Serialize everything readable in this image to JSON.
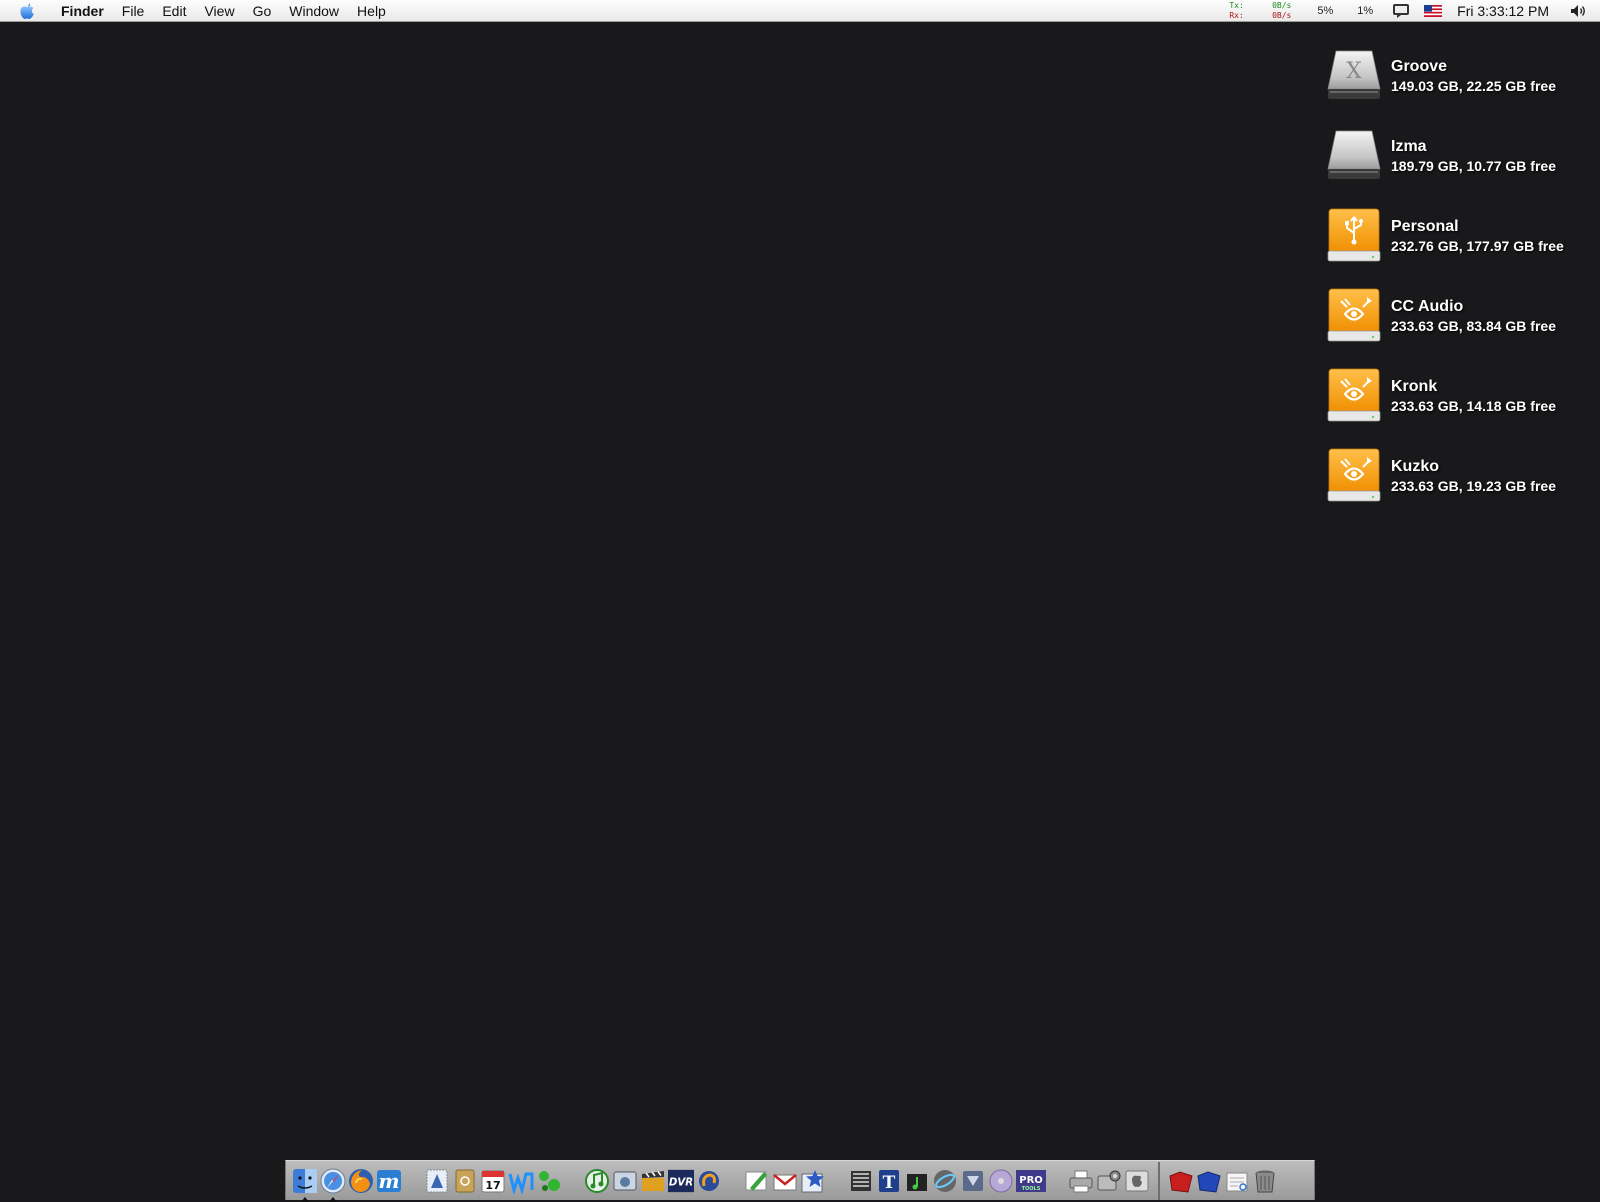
{
  "menubar": {
    "app_name": "Finder",
    "items": [
      "File",
      "Edit",
      "View",
      "Go",
      "Window",
      "Help"
    ],
    "network": {
      "tx_label": "Tx:",
      "tx_value": "0B/s",
      "rx_label": "Rx:",
      "rx_value": "0B/s"
    },
    "cpu_1": "5%",
    "cpu_2": "1%",
    "clock": "Fri 3:33:12 PM",
    "icons": [
      "apple-icon",
      "speech-bubble-icon",
      "us-flag-icon",
      "speaker-icon"
    ]
  },
  "volumes": [
    {
      "name": "Groove",
      "info": "149.03 GB, 22.25 GB free",
      "kind": "system-drive-icon"
    },
    {
      "name": "Izma",
      "info": "189.79 GB, 10.77 GB free",
      "kind": "hard-drive-icon"
    },
    {
      "name": "Personal",
      "info": "232.76 GB, 177.97 GB free",
      "kind": "usb-drive-icon"
    },
    {
      "name": "CC Audio",
      "info": "233.63 GB, 83.84 GB free",
      "kind": "firewire-drive-icon"
    },
    {
      "name": "Kronk",
      "info": "233.63 GB, 14.18 GB free",
      "kind": "firewire-drive-icon"
    },
    {
      "name": "Kuzko",
      "info": "233.63 GB, 19.23 GB free",
      "kind": "firewire-drive-icon"
    }
  ],
  "dock": {
    "logo_texts": {
      "dvr": "DVR",
      "pro": "PRO",
      "tools": "TOOLS",
      "t": "T",
      "m": "m"
    },
    "calendar_day": "17",
    "colors": {
      "orange": "#f6a312",
      "desktop": "#19191b"
    }
  }
}
